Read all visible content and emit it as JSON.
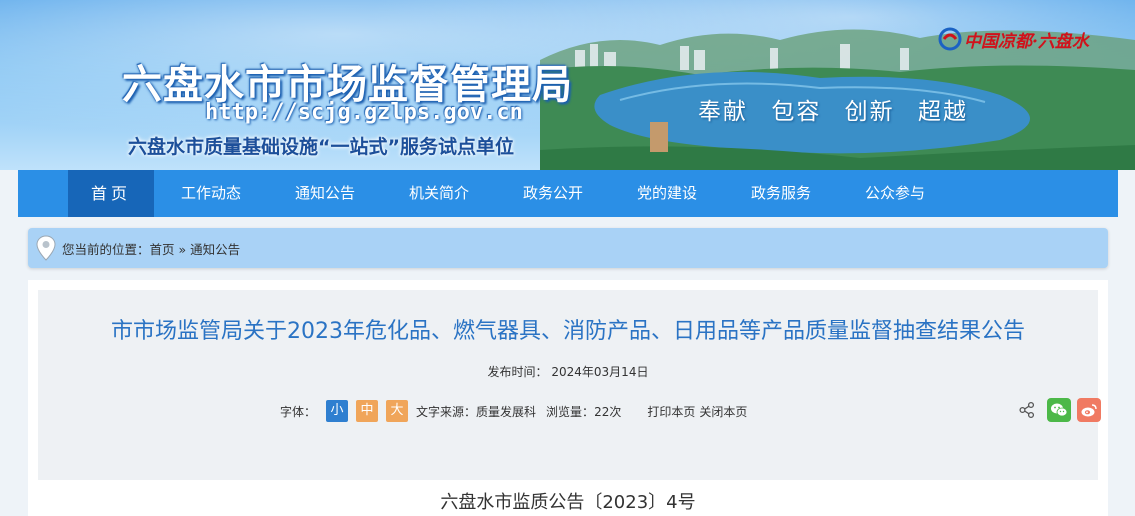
{
  "banner": {
    "title": "六盘水市市场监督管理局",
    "url": "http://scjg.gzlps.gov.cn",
    "subtitle": "六盘水市质量基础设施“一站式”服务试点单位",
    "slogans": [
      "奉献",
      "包容",
      "创新",
      "超越"
    ],
    "brand_text": "中国凉都·六盘水"
  },
  "nav": {
    "items": [
      "首页",
      "工作动态",
      "通知公告",
      "机关简介",
      "政务公开",
      "党的建设",
      "政务服务",
      "公众参与"
    ]
  },
  "breadcrumb": {
    "prefix": "您当前的位置：",
    "home": "首页",
    "separator": " » ",
    "current": "通知公告"
  },
  "article": {
    "title": "市市场监管局关于2023年危化品、燃气器具、消防产品、日用品等产品质量监督抽查结果公告",
    "date_label": "发布时间：",
    "date": "2024年03月14日",
    "font_label": "字体：",
    "font_small": "小",
    "font_mid": "中",
    "font_big": "大",
    "source_label": "文字来源：",
    "source": "质量发展科",
    "views_label": "浏览量：",
    "views": "22次",
    "print": "打印本页",
    "close": "关闭本页",
    "doc_number": "六盘水市监质公告〔2023〕4号"
  },
  "colors": {
    "nav_bg": "#2b8fe6",
    "nav_active": "#1766b8",
    "title": "#2a73c4",
    "font_small": "#2f7fd0",
    "font_mid_big": "#f0a55a",
    "wechat": "#4cb848",
    "weibo": "#f07a62"
  }
}
